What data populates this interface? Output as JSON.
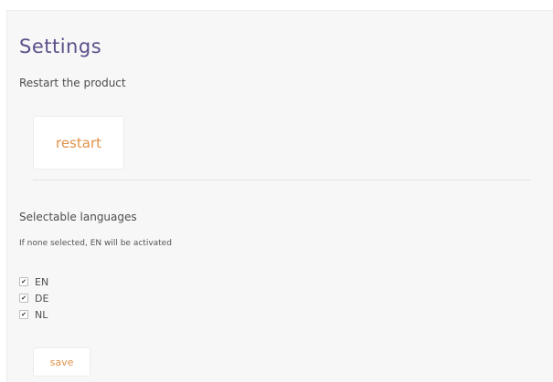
{
  "settings": {
    "title": "Settings",
    "restart_description": "Restart the product",
    "restart_button": "restart",
    "languages_title": "Selectable languages",
    "languages_note": "If none selected, EN will be activated",
    "languages": [
      {
        "label": "EN",
        "checked": true
      },
      {
        "label": "DE",
        "checked": true
      },
      {
        "label": "NL",
        "checked": true
      }
    ],
    "save_button": "save"
  },
  "colors": {
    "title": "#5c4f8a",
    "button_text": "#e0924a",
    "panel_bg": "#f7f7f7"
  }
}
